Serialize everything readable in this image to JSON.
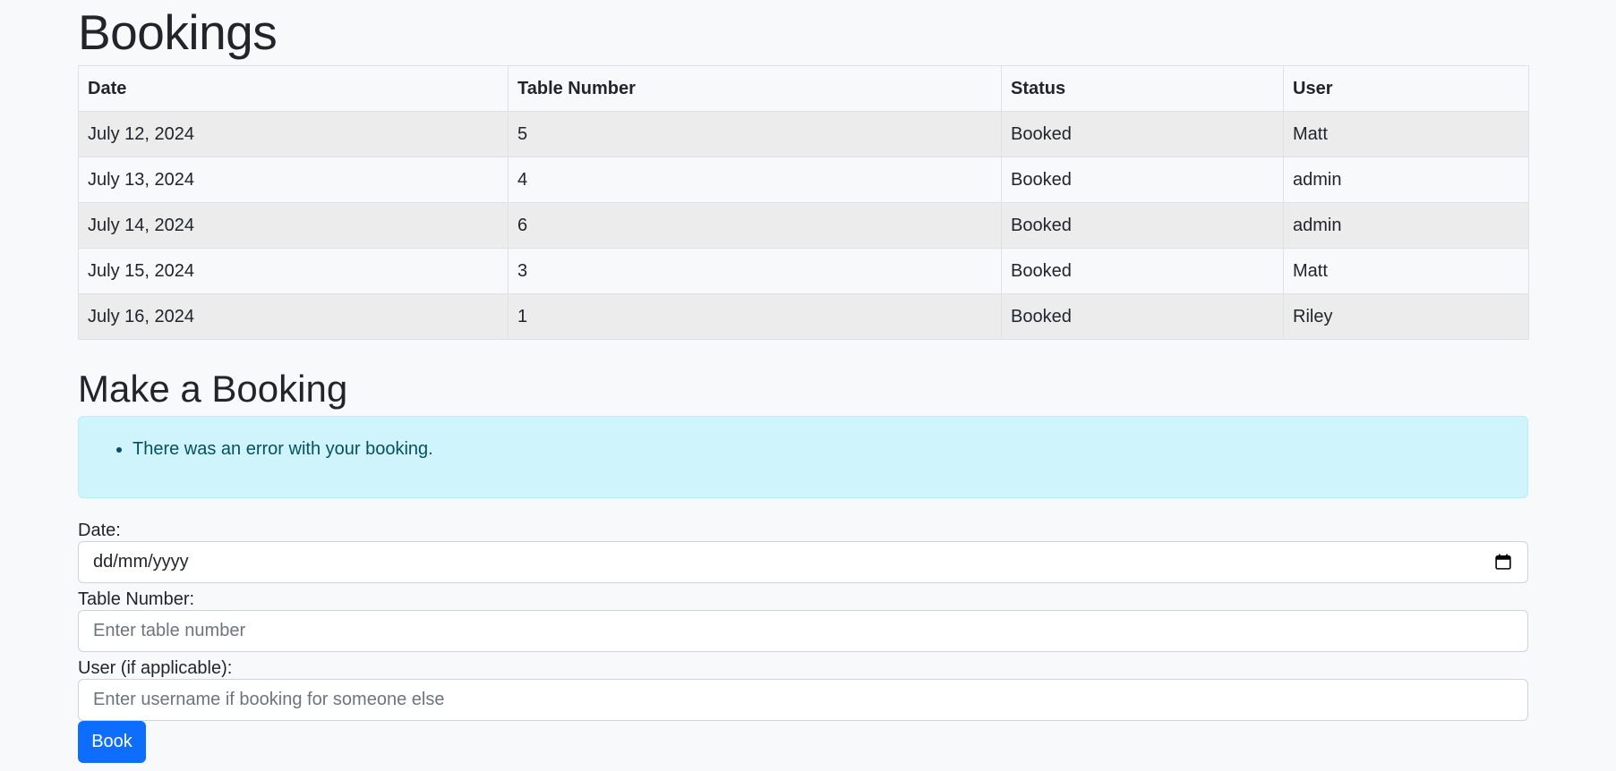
{
  "page": {
    "title": "Bookings"
  },
  "bookings_table": {
    "headers": [
      "Date",
      "Table Number",
      "Status",
      "User"
    ],
    "rows": [
      [
        "July 12, 2024",
        "5",
        "Booked",
        "Matt"
      ],
      [
        "July 13, 2024",
        "4",
        "Booked",
        "admin"
      ],
      [
        "July 14, 2024",
        "6",
        "Booked",
        "admin"
      ],
      [
        "July 15, 2024",
        "3",
        "Booked",
        "Matt"
      ],
      [
        "July 16, 2024",
        "1",
        "Booked",
        "Riley"
      ]
    ]
  },
  "booking_form": {
    "title": "Make a Booking",
    "alert_messages": [
      "There was an error with your booking."
    ],
    "date_label": "Date:",
    "date_value": "dd/mm/yyyy",
    "table_label": "Table Number:",
    "table_placeholder": "Enter table number",
    "user_label": "User (if applicable):",
    "user_placeholder": "Enter username if booking for someone else",
    "submit_label": "Book"
  },
  "icons": {
    "date_picker": "calendar-icon"
  },
  "colors": {
    "primary": "#0d6efd",
    "alert_bg": "#cff4fc",
    "alert_text": "#055160",
    "page_bg": "#f8f9fa"
  }
}
